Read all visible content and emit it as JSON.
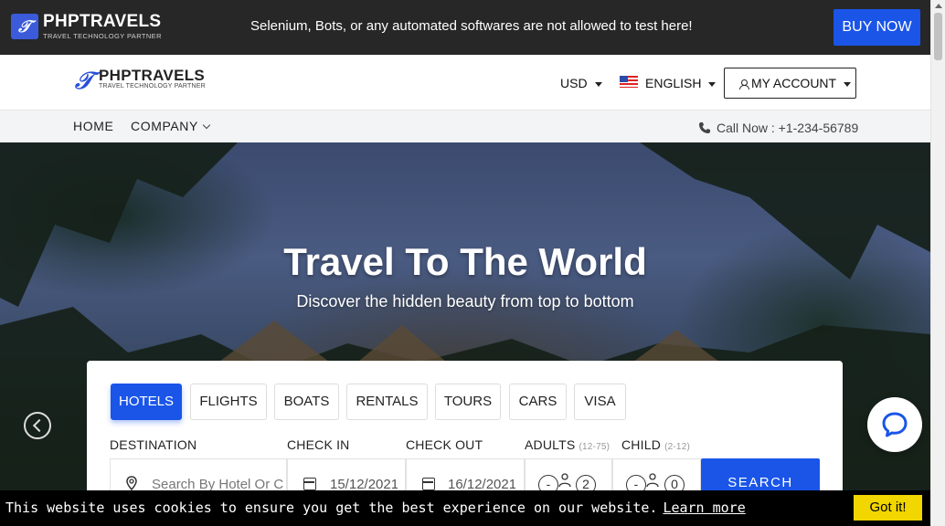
{
  "topbar": {
    "brand": "PHPTRAVELS",
    "brand_sub": "TRAVEL TECHNOLOGY PARTNER",
    "notice": "Selenium, Bots, or any automated softwares are not allowed to test here!",
    "buy_label": "BUY NOW"
  },
  "header": {
    "brand": "PHPTRAVELS",
    "brand_sub": "TRAVEL TECHNOLOGY PARTNER",
    "currency": "USD",
    "language": "ENGLISH",
    "account_label": "MY ACCOUNT"
  },
  "nav": {
    "items": [
      {
        "label": "HOME"
      },
      {
        "label": "COMPANY"
      }
    ],
    "call": "Call Now : +1-234-56789"
  },
  "hero": {
    "title": "Travel To The World",
    "subtitle": "Discover the hidden beauty from top to bottom"
  },
  "search": {
    "tabs": [
      {
        "label": "HOTELS",
        "active": true
      },
      {
        "label": "FLIGHTS"
      },
      {
        "label": "BOATS"
      },
      {
        "label": "RENTALS"
      },
      {
        "label": "TOURS"
      },
      {
        "label": "CARS"
      },
      {
        "label": "VISA"
      }
    ],
    "destination_label": "DESTINATION",
    "destination_placeholder": "Search By Hotel Or City Name",
    "checkin_label": "CHECK IN",
    "checkin_value": "15/12/2021",
    "checkout_label": "CHECK OUT",
    "checkout_value": "16/12/2021",
    "adults_label": "ADULTS",
    "adults_range": "(12-75)",
    "adults_value": "2",
    "child_label": "CHILD",
    "child_range": "(2-12)",
    "child_value": "0",
    "minus": "-",
    "search_label": "SEARCH"
  },
  "cookie": {
    "text": "This website uses cookies to ensure you get the best experience on our website.",
    "link": "Learn more",
    "button": "Got it!"
  },
  "colors": {
    "accent": "#1a55e8",
    "topbar_bg": "#272727",
    "cookie_button": "#f1d600"
  }
}
